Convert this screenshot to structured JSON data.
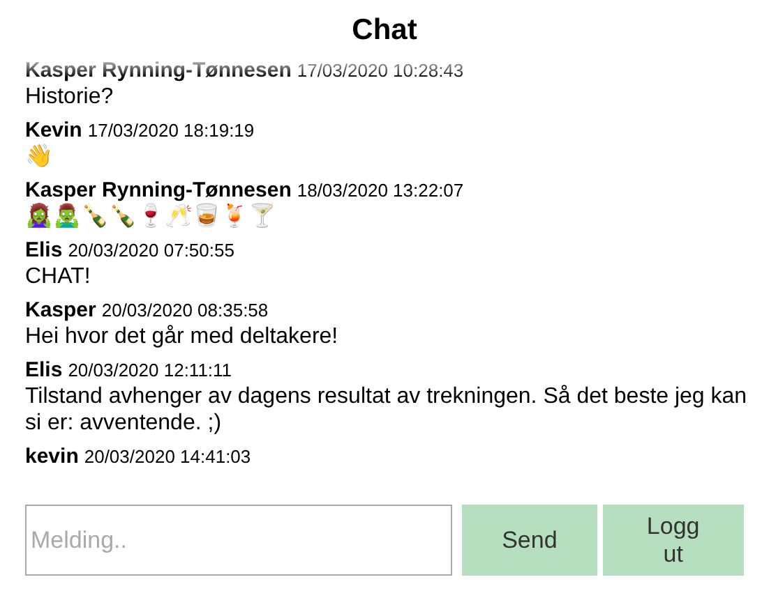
{
  "title": "Chat",
  "messages": [
    {
      "author": "Kasper Rynning-Tønnesen",
      "time": "17/03/2020 10:28:43",
      "text": "Historie?"
    },
    {
      "author": "Kevin",
      "time": "17/03/2020 18:19:19",
      "text": "👋"
    },
    {
      "author": "Kasper Rynning-Tønnesen",
      "time": "18/03/2020 13:22:07",
      "text": "🧟‍♀️🧟‍♂️🍾🍾🍷🥂🥃🍹🍸"
    },
    {
      "author": "Elis",
      "time": "20/03/2020 07:50:55",
      "text": "CHAT!"
    },
    {
      "author": "Kasper",
      "time": "20/03/2020 08:35:58",
      "text": "Hei hvor det går med deltakere!"
    },
    {
      "author": "Elis",
      "time": "20/03/2020 12:11:11",
      "text": "Tilstand avhenger av dagens resultat av trekningen. Så det beste jeg kan si er: avventende. ;)"
    },
    {
      "author": "kevin",
      "time": "20/03/2020 14:41:03"
    }
  ],
  "composer": {
    "placeholder": "Melding.."
  },
  "buttons": [
    "Send",
    "Logg ut"
  ]
}
